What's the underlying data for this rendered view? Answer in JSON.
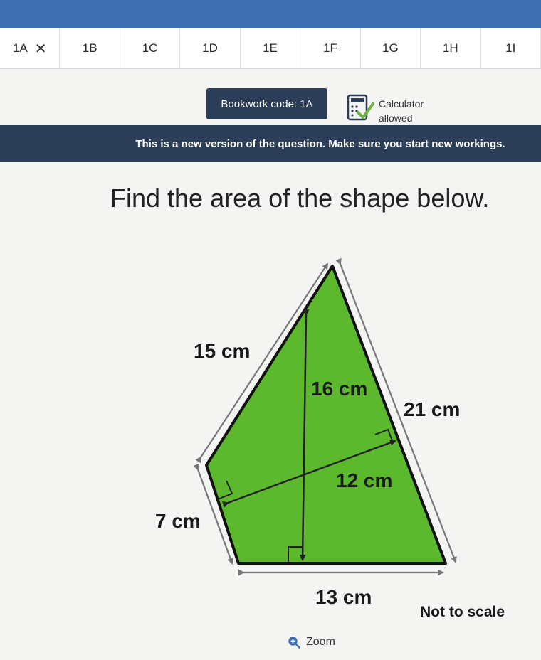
{
  "tabs": [
    {
      "label": "1A",
      "closable": true
    },
    {
      "label": "1B"
    },
    {
      "label": "1C"
    },
    {
      "label": "1D"
    },
    {
      "label": "1E"
    },
    {
      "label": "1F"
    },
    {
      "label": "1G"
    },
    {
      "label": "1H"
    },
    {
      "label": "1I"
    }
  ],
  "close_glyph": "✕",
  "bookwork_code": "Bookwork code: 1A",
  "calculator": {
    "line1": "Calculator",
    "line2": "allowed",
    "icon": "calculator-check-icon"
  },
  "banner": "This is a new version of the question. Make sure you start new workings.",
  "question": "Find the area of the shape below.",
  "diagram": {
    "fill": "#5cb82d",
    "labels": {
      "side_15": "15 cm",
      "side_7": "7 cm",
      "side_21": "21 cm",
      "base_13": "13 cm",
      "height_16": "16 cm",
      "height_12": "12 cm"
    },
    "not_to_scale": "Not to scale"
  },
  "zoom": {
    "label": "Zoom",
    "icon": "zoom-icon"
  }
}
